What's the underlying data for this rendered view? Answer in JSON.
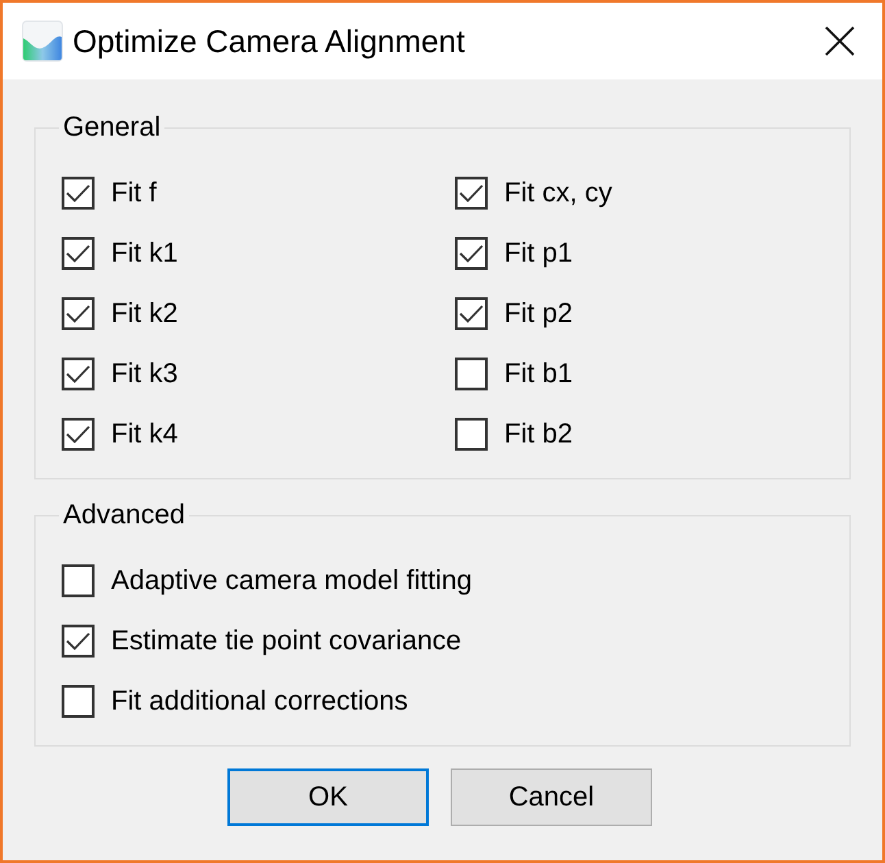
{
  "window": {
    "title": "Optimize Camera Alignment"
  },
  "general": {
    "title": "General",
    "columns": [
      [
        {
          "label": "Fit f",
          "checked": true
        },
        {
          "label": "Fit k1",
          "checked": true
        },
        {
          "label": "Fit k2",
          "checked": true
        },
        {
          "label": "Fit k3",
          "checked": true
        },
        {
          "label": "Fit k4",
          "checked": true
        }
      ],
      [
        {
          "label": "Fit cx, cy",
          "checked": true
        },
        {
          "label": "Fit p1",
          "checked": true
        },
        {
          "label": "Fit p2",
          "checked": true
        },
        {
          "label": "Fit b1",
          "checked": false
        },
        {
          "label": "Fit b2",
          "checked": false
        }
      ]
    ]
  },
  "advanced": {
    "title": "Advanced",
    "options": [
      {
        "label": "Adaptive camera model fitting",
        "checked": false
      },
      {
        "label": "Estimate tie point covariance",
        "checked": true
      },
      {
        "label": "Fit additional corrections",
        "checked": false
      }
    ]
  },
  "buttons": [
    {
      "label": "OK",
      "default": true
    },
    {
      "label": "Cancel",
      "default": false
    }
  ]
}
